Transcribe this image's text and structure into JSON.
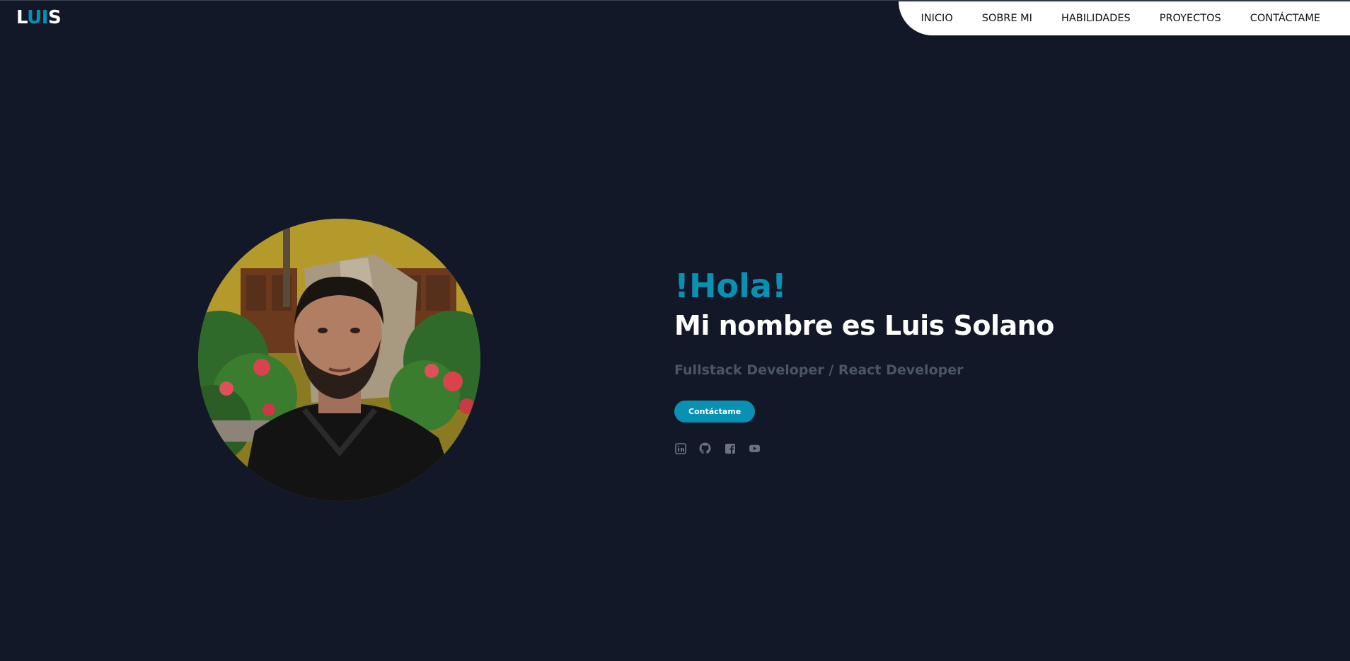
{
  "brand": {
    "logo_first": "L",
    "logo_accent": "UI",
    "logo_last": "S"
  },
  "nav": {
    "items": [
      {
        "label": "INICIO"
      },
      {
        "label": "SOBRE MI"
      },
      {
        "label": "HABILIDADES"
      },
      {
        "label": "PROYECTOS"
      },
      {
        "label": "CONTÁCTAME"
      }
    ]
  },
  "hero": {
    "greeting": "!Hola!",
    "name": "Mi nombre es Luis Solano",
    "role": "Fullstack Developer / React Developer",
    "cta_label": "Contáctame"
  },
  "socials": [
    {
      "icon": "linkedin-icon"
    },
    {
      "icon": "github-icon"
    },
    {
      "icon": "facebook-icon"
    },
    {
      "icon": "youtube-icon"
    }
  ],
  "colors": {
    "background": "#121827",
    "accent": "#0891b2",
    "nav_background": "#ffffff",
    "muted_text": "#4b5563",
    "icon": "#6b7280"
  }
}
